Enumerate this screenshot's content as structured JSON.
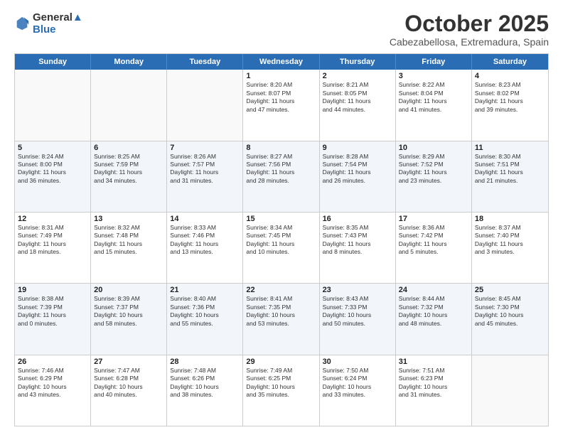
{
  "header": {
    "logo_line1": "General",
    "logo_line2": "Blue",
    "month": "October 2025",
    "location": "Cabezabellosa, Extremadura, Spain"
  },
  "weekdays": [
    "Sunday",
    "Monday",
    "Tuesday",
    "Wednesday",
    "Thursday",
    "Friday",
    "Saturday"
  ],
  "rows": [
    [
      {
        "day": "",
        "text": ""
      },
      {
        "day": "",
        "text": ""
      },
      {
        "day": "",
        "text": ""
      },
      {
        "day": "1",
        "text": "Sunrise: 8:20 AM\nSunset: 8:07 PM\nDaylight: 11 hours\nand 47 minutes."
      },
      {
        "day": "2",
        "text": "Sunrise: 8:21 AM\nSunset: 8:05 PM\nDaylight: 11 hours\nand 44 minutes."
      },
      {
        "day": "3",
        "text": "Sunrise: 8:22 AM\nSunset: 8:04 PM\nDaylight: 11 hours\nand 41 minutes."
      },
      {
        "day": "4",
        "text": "Sunrise: 8:23 AM\nSunset: 8:02 PM\nDaylight: 11 hours\nand 39 minutes."
      }
    ],
    [
      {
        "day": "5",
        "text": "Sunrise: 8:24 AM\nSunset: 8:00 PM\nDaylight: 11 hours\nand 36 minutes."
      },
      {
        "day": "6",
        "text": "Sunrise: 8:25 AM\nSunset: 7:59 PM\nDaylight: 11 hours\nand 34 minutes."
      },
      {
        "day": "7",
        "text": "Sunrise: 8:26 AM\nSunset: 7:57 PM\nDaylight: 11 hours\nand 31 minutes."
      },
      {
        "day": "8",
        "text": "Sunrise: 8:27 AM\nSunset: 7:56 PM\nDaylight: 11 hours\nand 28 minutes."
      },
      {
        "day": "9",
        "text": "Sunrise: 8:28 AM\nSunset: 7:54 PM\nDaylight: 11 hours\nand 26 minutes."
      },
      {
        "day": "10",
        "text": "Sunrise: 8:29 AM\nSunset: 7:52 PM\nDaylight: 11 hours\nand 23 minutes."
      },
      {
        "day": "11",
        "text": "Sunrise: 8:30 AM\nSunset: 7:51 PM\nDaylight: 11 hours\nand 21 minutes."
      }
    ],
    [
      {
        "day": "12",
        "text": "Sunrise: 8:31 AM\nSunset: 7:49 PM\nDaylight: 11 hours\nand 18 minutes."
      },
      {
        "day": "13",
        "text": "Sunrise: 8:32 AM\nSunset: 7:48 PM\nDaylight: 11 hours\nand 15 minutes."
      },
      {
        "day": "14",
        "text": "Sunrise: 8:33 AM\nSunset: 7:46 PM\nDaylight: 11 hours\nand 13 minutes."
      },
      {
        "day": "15",
        "text": "Sunrise: 8:34 AM\nSunset: 7:45 PM\nDaylight: 11 hours\nand 10 minutes."
      },
      {
        "day": "16",
        "text": "Sunrise: 8:35 AM\nSunset: 7:43 PM\nDaylight: 11 hours\nand 8 minutes."
      },
      {
        "day": "17",
        "text": "Sunrise: 8:36 AM\nSunset: 7:42 PM\nDaylight: 11 hours\nand 5 minutes."
      },
      {
        "day": "18",
        "text": "Sunrise: 8:37 AM\nSunset: 7:40 PM\nDaylight: 11 hours\nand 3 minutes."
      }
    ],
    [
      {
        "day": "19",
        "text": "Sunrise: 8:38 AM\nSunset: 7:39 PM\nDaylight: 11 hours\nand 0 minutes."
      },
      {
        "day": "20",
        "text": "Sunrise: 8:39 AM\nSunset: 7:37 PM\nDaylight: 10 hours\nand 58 minutes."
      },
      {
        "day": "21",
        "text": "Sunrise: 8:40 AM\nSunset: 7:36 PM\nDaylight: 10 hours\nand 55 minutes."
      },
      {
        "day": "22",
        "text": "Sunrise: 8:41 AM\nSunset: 7:35 PM\nDaylight: 10 hours\nand 53 minutes."
      },
      {
        "day": "23",
        "text": "Sunrise: 8:43 AM\nSunset: 7:33 PM\nDaylight: 10 hours\nand 50 minutes."
      },
      {
        "day": "24",
        "text": "Sunrise: 8:44 AM\nSunset: 7:32 PM\nDaylight: 10 hours\nand 48 minutes."
      },
      {
        "day": "25",
        "text": "Sunrise: 8:45 AM\nSunset: 7:30 PM\nDaylight: 10 hours\nand 45 minutes."
      }
    ],
    [
      {
        "day": "26",
        "text": "Sunrise: 7:46 AM\nSunset: 6:29 PM\nDaylight: 10 hours\nand 43 minutes."
      },
      {
        "day": "27",
        "text": "Sunrise: 7:47 AM\nSunset: 6:28 PM\nDaylight: 10 hours\nand 40 minutes."
      },
      {
        "day": "28",
        "text": "Sunrise: 7:48 AM\nSunset: 6:26 PM\nDaylight: 10 hours\nand 38 minutes."
      },
      {
        "day": "29",
        "text": "Sunrise: 7:49 AM\nSunset: 6:25 PM\nDaylight: 10 hours\nand 35 minutes."
      },
      {
        "day": "30",
        "text": "Sunrise: 7:50 AM\nSunset: 6:24 PM\nDaylight: 10 hours\nand 33 minutes."
      },
      {
        "day": "31",
        "text": "Sunrise: 7:51 AM\nSunset: 6:23 PM\nDaylight: 10 hours\nand 31 minutes."
      },
      {
        "day": "",
        "text": ""
      }
    ]
  ]
}
